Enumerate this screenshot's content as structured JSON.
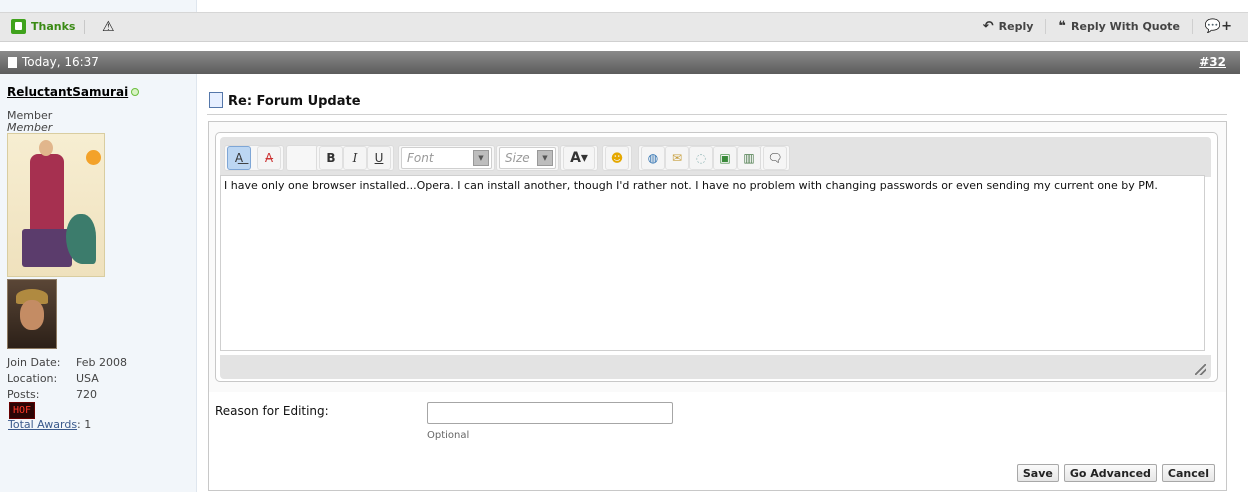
{
  "action_bar": {
    "thanks_label": "Thanks",
    "warn_icon": "warning-icon",
    "reply_label": "Reply",
    "reply_quote_label": "Reply With Quote",
    "multiquote_icon": "multiquote-plus-icon"
  },
  "post_header": {
    "date": "Today, 16:37",
    "post_number": "#32"
  },
  "user": {
    "username": "ReluctantSamurai",
    "rank": "Member",
    "usertitle": "Member",
    "join_date_label": "Join Date:",
    "join_date": "Feb 2008",
    "location_label": "Location:",
    "location": "USA",
    "posts_label": "Posts:",
    "posts": "720",
    "hof_badge": "HOF",
    "awards_link": "Total Awards",
    "awards_count": ": 1"
  },
  "post": {
    "title": "Re: Forum Update"
  },
  "editor": {
    "font_placeholder": "Font",
    "size_placeholder": "Size",
    "bold": "B",
    "italic": "I",
    "underline": "U",
    "text": "I have only one browser installed...Opera. I can install another, though I'd rather not. I have no problem with changing passwords or even sending my current one by PM."
  },
  "reason": {
    "label": "Reason for Editing:",
    "value": "",
    "optional": "Optional"
  },
  "buttons": {
    "save": "Save",
    "go_advanced": "Go Advanced",
    "cancel": "Cancel"
  },
  "colors": {
    "thanks_green": "#3a8a14",
    "header_gray": "#6e6e6e",
    "sidebar_bg": "#f2f6fa",
    "link_blue": "#3b5a8c"
  }
}
